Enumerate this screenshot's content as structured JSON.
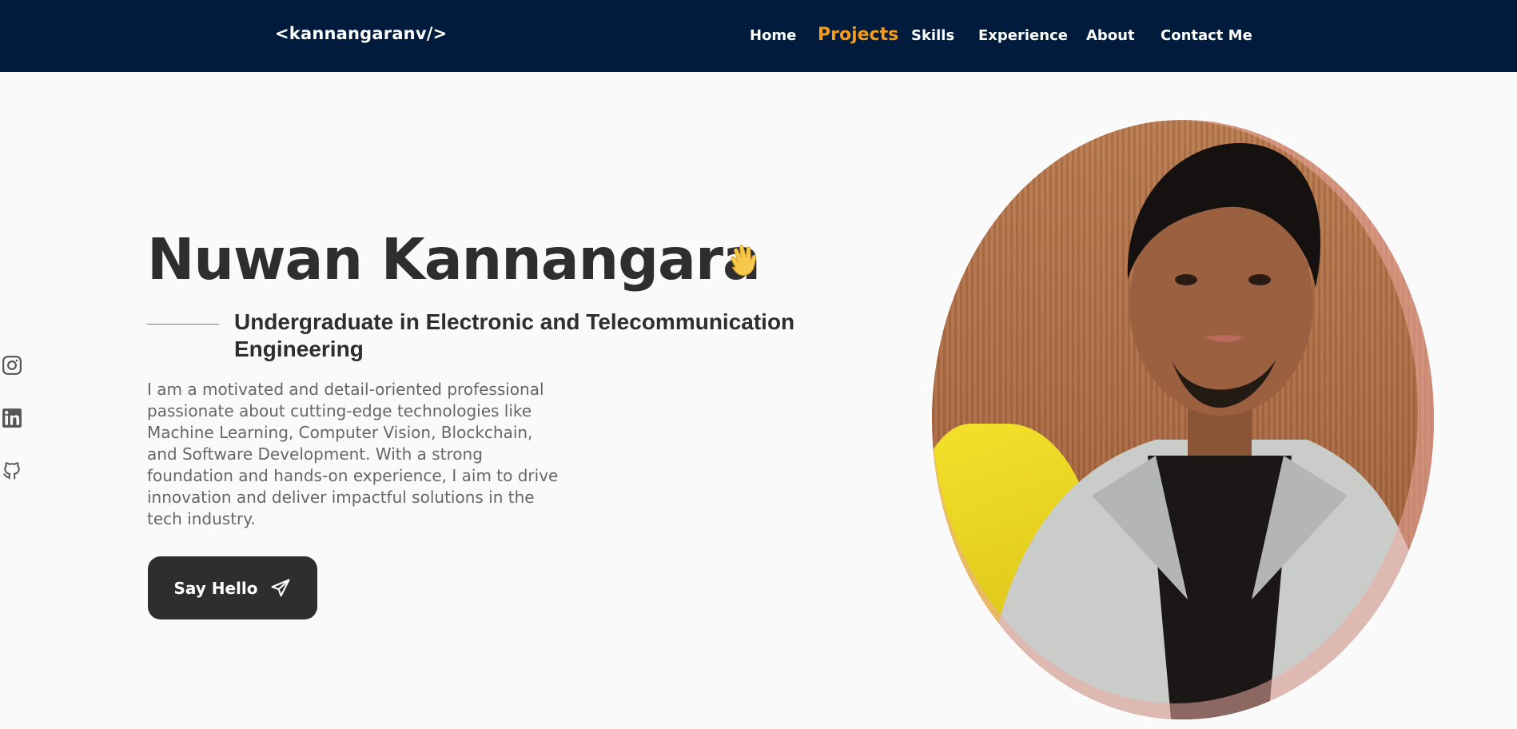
{
  "nav": {
    "logo": "<kannangaranv/>",
    "links": [
      "Home",
      "Projects",
      "Skills",
      "Experience",
      "About",
      "Contact Me"
    ],
    "active": "Projects",
    "active_color": "#f29b1d",
    "background": "#011b3c"
  },
  "socials": {
    "icons": [
      "instagram-icon",
      "linkedin-icon",
      "github-icon"
    ]
  },
  "hero": {
    "name": "Nuwan Kannangara",
    "wave_icon": "waving-hand-icon",
    "subtitle": "Undergraduate in Electronic and Telecommunication Engineering",
    "description": "I am a motivated and detail-oriented professional passionate about cutting-edge technologies like Machine Learning, Computer Vision, Blockchain, and Software Development. With a strong foundation and hands-on experience, I aim to drive innovation and deliver impactful solutions in the tech industry.",
    "button_label": "Say Hello",
    "button_icon": "send-icon"
  },
  "photo": {
    "subject": "portrait-photo"
  }
}
